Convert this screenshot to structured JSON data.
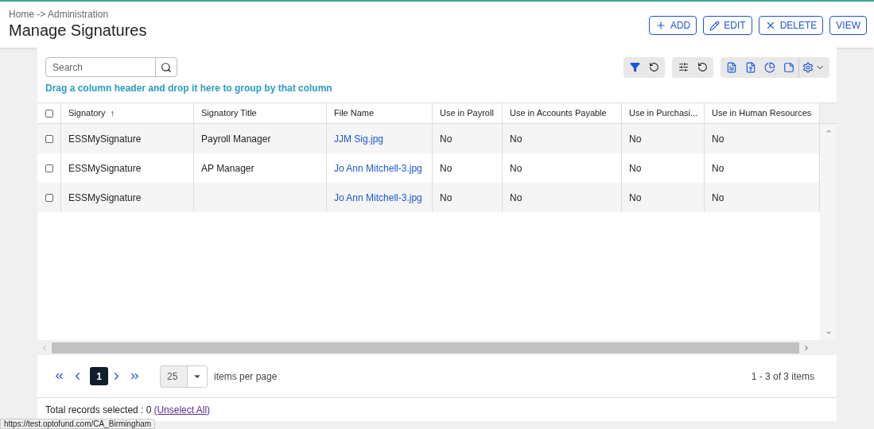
{
  "breadcrumb": "Home -> Administration",
  "title": "Manage Signatures",
  "actions": [
    {
      "kind": "add",
      "label": "ADD"
    },
    {
      "kind": "edit",
      "label": "EDIT"
    },
    {
      "kind": "delete",
      "label": "DELETE"
    },
    {
      "kind": "view",
      "label": "VIEW"
    }
  ],
  "search": {
    "placeholder": "Search"
  },
  "group_hint": "Drag a column header and drop it here to group by that column",
  "table": {
    "columns": [
      "Signatory",
      "Signatory Title",
      "File Name",
      "Use in Payroll",
      "Use in Accounts Payable",
      "Use in Purchasi...",
      "Use in Human Resources"
    ],
    "sort_arrow": "↑",
    "select_all_checked": false,
    "rows": [
      {
        "checked": false,
        "cells": [
          "ESSMySignature",
          "Payroll Manager",
          "JJM Sig.jpg",
          "No",
          "No",
          "No",
          "No"
        ]
      },
      {
        "checked": false,
        "cells": [
          "ESSMySignature",
          "AP Manager",
          "Jo Ann Mitchell-3.jpg",
          "No",
          "No",
          "No",
          "No"
        ]
      },
      {
        "checked": false,
        "cells": [
          "ESSMySignature",
          "",
          "Jo Ann Mitchell-3.jpg",
          "No",
          "No",
          "No",
          "No"
        ]
      }
    ]
  },
  "pager": {
    "pages": [
      {
        "label": "1",
        "selected": true
      }
    ],
    "page_size": "25",
    "page_size_label": "items per page",
    "summary": "1 - 3 of 3 items"
  },
  "footer": {
    "text": "Total records selected : 0",
    "link": "(Unselect All)"
  },
  "status_url": "https://test.optofund.com/CA_Birmingham"
}
